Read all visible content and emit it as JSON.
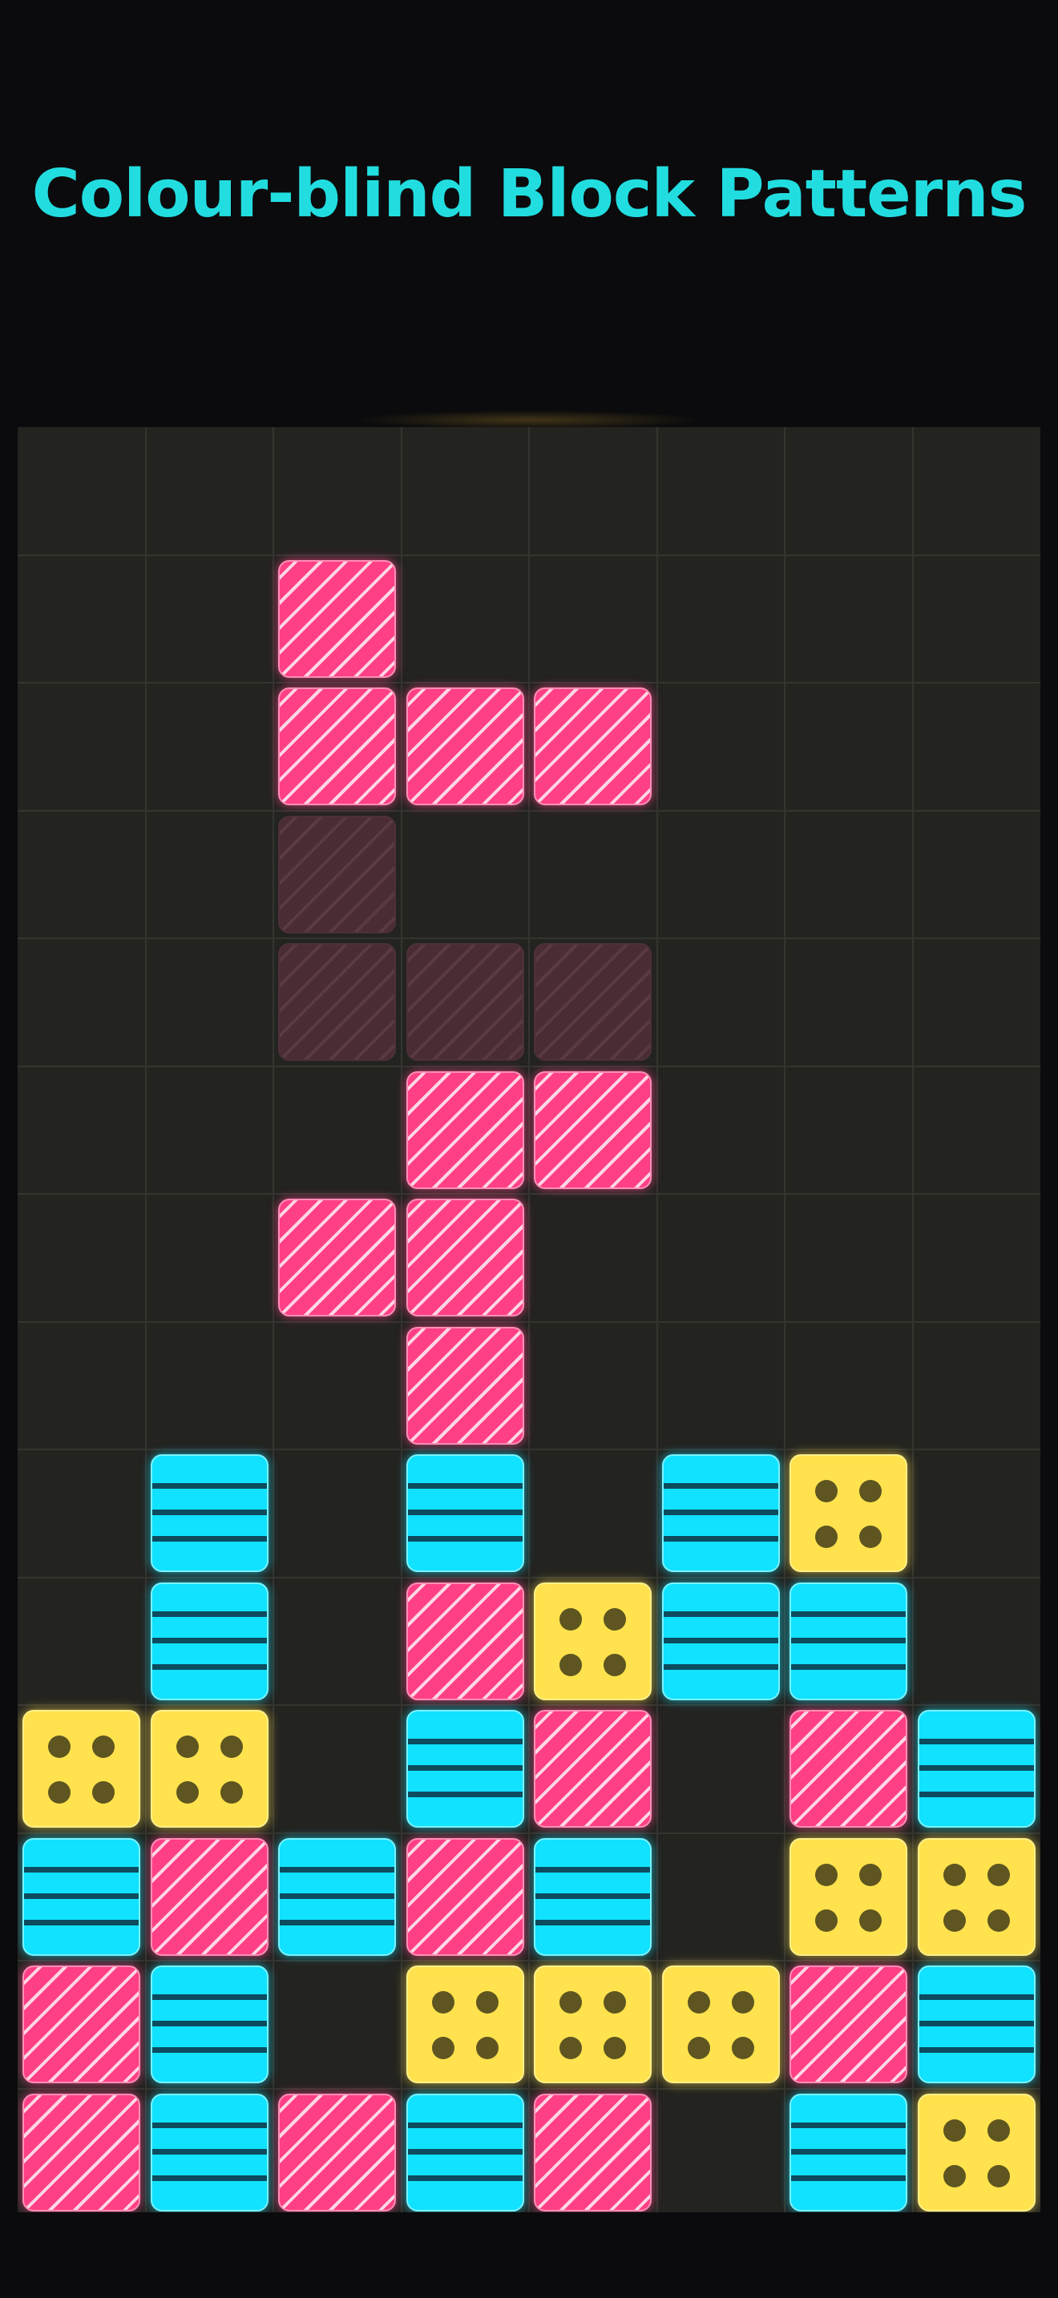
{
  "title": "Colour-blind Block Patterns",
  "colors": {
    "background": "#0b0b0d",
    "board": "#232320",
    "title": "#22dde0",
    "pink": "#ff3f86",
    "cyan": "#10e2ff",
    "yellow": "#ffe24d",
    "ghost": "#4a2c35"
  },
  "board": {
    "columns": 8,
    "rows": 14,
    "cells": [
      {
        "row": 1,
        "col": 2,
        "type": "pink"
      },
      {
        "row": 2,
        "col": 2,
        "type": "pink"
      },
      {
        "row": 2,
        "col": 3,
        "type": "pink"
      },
      {
        "row": 2,
        "col": 4,
        "type": "pink"
      },
      {
        "row": 3,
        "col": 2,
        "type": "ghost"
      },
      {
        "row": 4,
        "col": 2,
        "type": "ghost"
      },
      {
        "row": 4,
        "col": 3,
        "type": "ghost"
      },
      {
        "row": 4,
        "col": 4,
        "type": "ghost"
      },
      {
        "row": 5,
        "col": 3,
        "type": "pink"
      },
      {
        "row": 5,
        "col": 4,
        "type": "pink"
      },
      {
        "row": 6,
        "col": 2,
        "type": "pink"
      },
      {
        "row": 6,
        "col": 3,
        "type": "pink"
      },
      {
        "row": 7,
        "col": 3,
        "type": "pink"
      },
      {
        "row": 8,
        "col": 1,
        "type": "cyan"
      },
      {
        "row": 8,
        "col": 3,
        "type": "cyan"
      },
      {
        "row": 8,
        "col": 5,
        "type": "cyan"
      },
      {
        "row": 8,
        "col": 6,
        "type": "yellow"
      },
      {
        "row": 9,
        "col": 1,
        "type": "cyan"
      },
      {
        "row": 9,
        "col": 3,
        "type": "pink"
      },
      {
        "row": 9,
        "col": 4,
        "type": "yellow"
      },
      {
        "row": 9,
        "col": 5,
        "type": "cyan"
      },
      {
        "row": 9,
        "col": 6,
        "type": "cyan"
      },
      {
        "row": 10,
        "col": 0,
        "type": "yellow"
      },
      {
        "row": 10,
        "col": 1,
        "type": "yellow"
      },
      {
        "row": 10,
        "col": 3,
        "type": "cyan"
      },
      {
        "row": 10,
        "col": 4,
        "type": "pink"
      },
      {
        "row": 10,
        "col": 6,
        "type": "pink"
      },
      {
        "row": 10,
        "col": 7,
        "type": "cyan"
      },
      {
        "row": 11,
        "col": 0,
        "type": "cyan"
      },
      {
        "row": 11,
        "col": 1,
        "type": "pink"
      },
      {
        "row": 11,
        "col": 2,
        "type": "cyan"
      },
      {
        "row": 11,
        "col": 3,
        "type": "pink"
      },
      {
        "row": 11,
        "col": 4,
        "type": "cyan"
      },
      {
        "row": 11,
        "col": 6,
        "type": "yellow"
      },
      {
        "row": 11,
        "col": 7,
        "type": "yellow"
      },
      {
        "row": 12,
        "col": 0,
        "type": "pink"
      },
      {
        "row": 12,
        "col": 1,
        "type": "cyan"
      },
      {
        "row": 12,
        "col": 3,
        "type": "yellow"
      },
      {
        "row": 12,
        "col": 4,
        "type": "yellow"
      },
      {
        "row": 12,
        "col": 5,
        "type": "yellow"
      },
      {
        "row": 12,
        "col": 6,
        "type": "pink"
      },
      {
        "row": 12,
        "col": 7,
        "type": "cyan"
      },
      {
        "row": 13,
        "col": 0,
        "type": "pink"
      },
      {
        "row": 13,
        "col": 1,
        "type": "cyan"
      },
      {
        "row": 13,
        "col": 2,
        "type": "pink"
      },
      {
        "row": 13,
        "col": 3,
        "type": "cyan"
      },
      {
        "row": 13,
        "col": 4,
        "type": "pink"
      },
      {
        "row": 13,
        "col": 6,
        "type": "cyan"
      },
      {
        "row": 13,
        "col": 7,
        "type": "yellow"
      }
    ]
  }
}
